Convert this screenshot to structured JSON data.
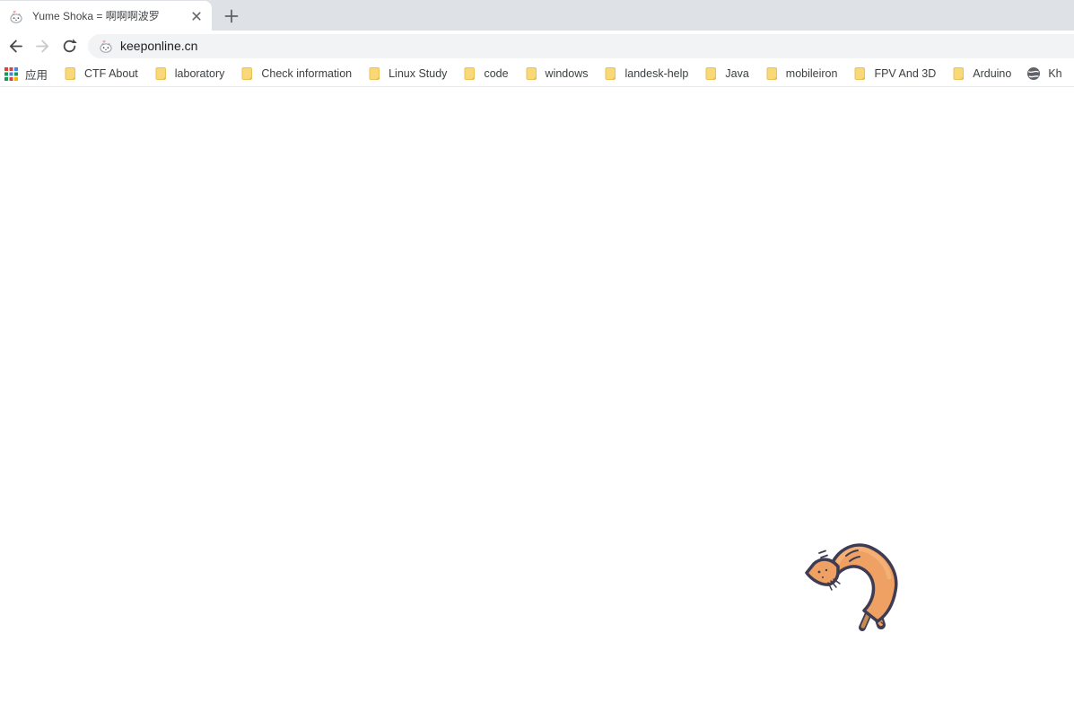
{
  "tab_strip": {
    "tab": {
      "title": "Yume Shoka = 啊啊啊波罗",
      "favicon": "cat-face-heart-icon"
    },
    "close_icon": "close-x",
    "new_tab_icon": "plus"
  },
  "toolbar": {
    "back_icon": "back-arrow",
    "forward_icon": "forward-arrow-disabled",
    "reload_icon": "reload-circular-arrow",
    "address_bar": {
      "favicon": "cat-face-heart-icon",
      "url": "keeponline.cn"
    }
  },
  "bookmarks_bar": {
    "items": [
      {
        "label": "应用",
        "icon": "apps-grid"
      },
      {
        "label": "CTF About",
        "icon": "folder"
      },
      {
        "label": "laboratory",
        "icon": "folder"
      },
      {
        "label": "Check information",
        "icon": "folder"
      },
      {
        "label": "Linux Study",
        "icon": "folder"
      },
      {
        "label": "code",
        "icon": "folder"
      },
      {
        "label": "windows",
        "icon": "folder"
      },
      {
        "label": "landesk-help",
        "icon": "folder"
      },
      {
        "label": "Java",
        "icon": "folder"
      },
      {
        "label": "mobileiron",
        "icon": "folder"
      },
      {
        "label": "FPV And 3D",
        "icon": "folder"
      },
      {
        "label": "Arduino",
        "icon": "folder"
      },
      {
        "label": "Kh",
        "icon": "globe"
      }
    ]
  },
  "page": {
    "illustration": "curled-jumping-cat"
  },
  "colors": {
    "tab_strip_bg": "#dee1e6",
    "toolbar_bg": "#ffffff",
    "omnibox_bg": "#f1f3f4",
    "ui_text": "#3c4043",
    "folder_yellow": "#f9d878",
    "favicon_heart_pink": "#f2a0b5",
    "cat_body_orange": "#efa063",
    "cat_highlight": "#f4b378",
    "cat_outline": "#3d3c52",
    "cat_leg_tan": "#c48b52"
  }
}
